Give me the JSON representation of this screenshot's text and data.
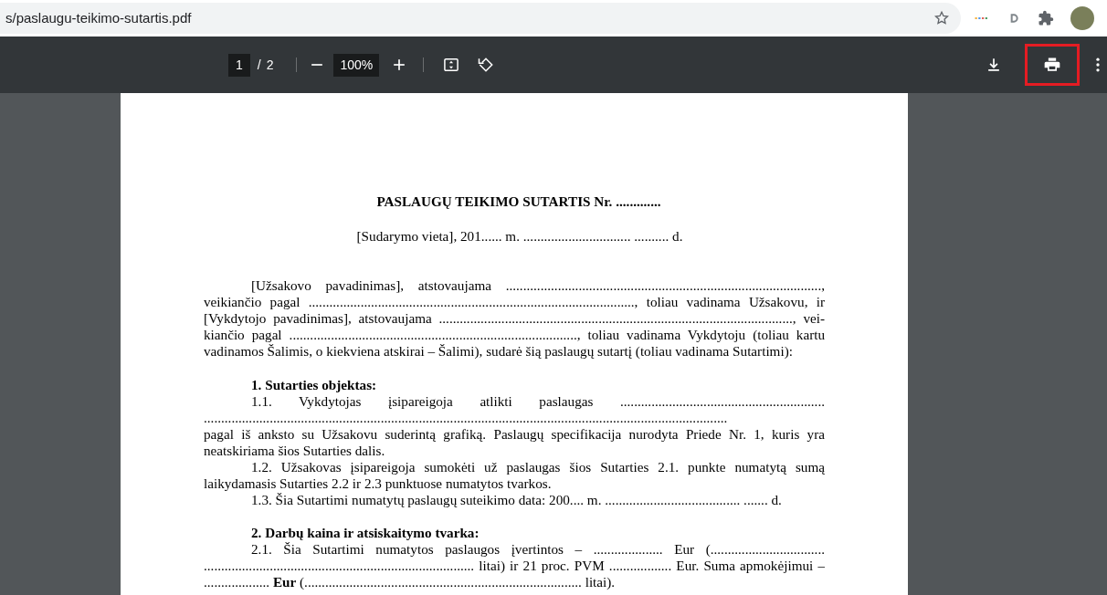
{
  "address_bar": {
    "url": "s/paslaugu-teikimo-sutartis.pdf"
  },
  "pdf_toolbar": {
    "page_current": "1",
    "page_separator": "/",
    "page_total": "2",
    "zoom": "100%",
    "print_highlighted": true
  },
  "document": {
    "title": "PASLAUGŲ TEIKIMO SUTARTIS Nr. .............",
    "place_date": "[Sudarymo vieta], 201...... m. ............................... .......... d.",
    "blocks": [
      {
        "kind": "paragraph",
        "lines": [
          "[Užsakovo pavadinimas], atstovaujama ...........................................................................................,",
          "veikiančio pagal .............................................................................................., toliau vadinama Užsakovu, ir",
          "[Vykdytojo pavadinimas], atstovaujama ......................................................................................................, vei-",
          "kiančio pagal ..................................................................................., toliau vadinama Vykdytoju (toliau kartu",
          "vadinamos Šalimis, o kiekviena atskirai – Šalimi), sudarė šią paslaugų sutartį (toliau vadinama Sutartimi):"
        ]
      },
      {
        "kind": "heading",
        "text": "1. Sutarties objektas:"
      },
      {
        "kind": "paragraph",
        "lines": [
          "1.1. Vykdytojas įsipareigoja atlikti paslaugas ...........................................................",
          ".......................................................................................................................................................",
          "pagal iš anksto su Užsakovu suderintą grafiką. Paslaugų specifikacija nurodyta Priede Nr. 1, kuris yra",
          "neatskiriama šios Sutarties dalis."
        ]
      },
      {
        "kind": "paragraph",
        "lines": [
          "1.2. Užsakovas įsipareigoja sumokėti už paslaugas šios Sutarties 2.1. punkte numatytą sumą",
          "laikydamasis Sutarties 2.2 ir 2.3 punktuose numatytos tvarkos."
        ]
      },
      {
        "kind": "paragraph",
        "lines": [
          "1.3. Šia Sutartimi numatytų paslaugų suteikimo data: 200.... m. ....................................... ....... d."
        ]
      },
      {
        "kind": "heading",
        "text": "2. Darbų kaina ir atsiskaitymo tvarka:"
      },
      {
        "kind": "paragraph",
        "lines": [
          "2.1. Šia Sutartimi numatytos paslaugos įvertintos – .................... Eur (.................................",
          ".............................................................................. litai) ir 21 proc. PVM .................. Eur. Suma apmokėjimui –",
          "................... **Eur** (................................................................................ litai)."
        ]
      }
    ]
  }
}
